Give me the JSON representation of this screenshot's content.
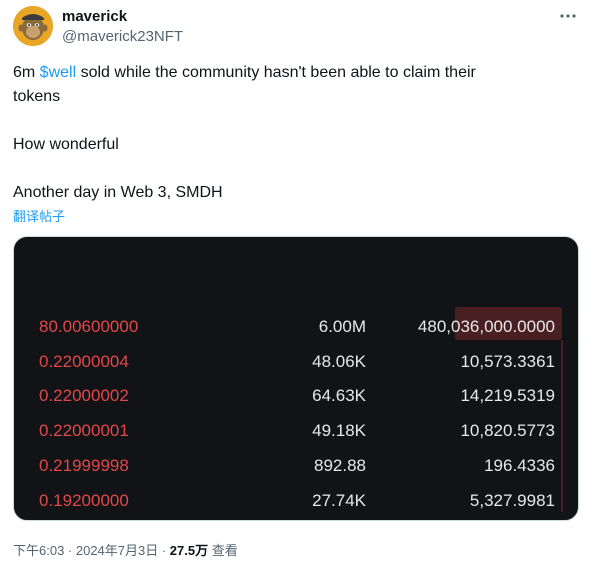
{
  "user": {
    "name": "maverick",
    "handle": "@maverick23NFT"
  },
  "tweet": {
    "line1_pre": "6m ",
    "cashtag": "$well",
    "line1_post": " sold while the community hasn't been able to claim their",
    "line2": "tokens",
    "para2": "How wonderful",
    "para3": "Another day in Web 3, SMDH",
    "translate_label": "翻译帖子"
  },
  "orderbook": {
    "rows": [
      {
        "price": "80.00600000",
        "amount": "6.00M",
        "total": "480,036,000.0000"
      },
      {
        "price": "0.22000004",
        "amount": "48.06K",
        "total": "10,573.3361"
      },
      {
        "price": "0.22000002",
        "amount": "64.63K",
        "total": "14,219.5319"
      },
      {
        "price": "0.22000001",
        "amount": "49.18K",
        "total": "10,820.5773"
      },
      {
        "price": "0.21999998",
        "amount": "892.88",
        "total": "196.4336"
      },
      {
        "price": "0.19200000",
        "amount": "27.74K",
        "total": "5,327.9981"
      }
    ]
  },
  "footer": {
    "time": "下午6:03 · 2024年7月3日 · ",
    "views_count": "27.5万",
    "views_label": " 查看"
  },
  "colors": {
    "accent": "#1d9bf0",
    "sell_red": "#e0484a",
    "highlight": "#4a1f22",
    "media_bg": "#121316"
  },
  "icons": {
    "more": "more-horizontal-icon",
    "avatar": "ape-avatar"
  }
}
